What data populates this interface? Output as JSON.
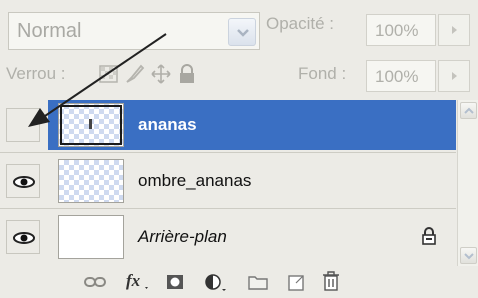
{
  "blend": {
    "mode": "Normal"
  },
  "opacity": {
    "label": "Opacité :",
    "value": "100%"
  },
  "lock": {
    "label": "Verrou :"
  },
  "fill": {
    "label": "Fond :",
    "value": "100%"
  },
  "layers": [
    {
      "name": "ananas",
      "visible": false,
      "selected": true,
      "icon": "checker-thumbnail"
    },
    {
      "name": "ombre_ananas",
      "visible": true,
      "selected": false,
      "icon": "checker-thumbnail"
    },
    {
      "name": "Arrière-plan",
      "visible": true,
      "selected": false,
      "icon": "white-thumbnail",
      "locked": true
    }
  ],
  "colors": {
    "selection": "#3a6fc3",
    "panel": "#ecebe6",
    "annotation": "#222222"
  },
  "toolbar_icons": [
    "link-icon",
    "fx-icon",
    "mask-icon",
    "adjustment-icon",
    "folder-icon",
    "new-layer-icon",
    "trash-icon"
  ]
}
